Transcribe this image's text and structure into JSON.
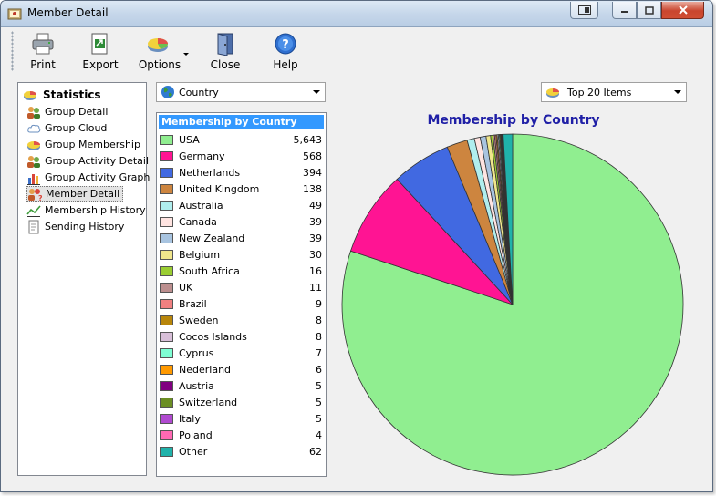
{
  "window": {
    "title": "Member Detail"
  },
  "toolbar": {
    "print_label": "Print",
    "export_label": "Export",
    "options_label": "Options",
    "close_label": "Close",
    "help_label": "Help"
  },
  "sidebar": {
    "heading": "Statistics",
    "items": [
      {
        "label": "Group Detail",
        "icon": "people-icon"
      },
      {
        "label": "Group Cloud",
        "icon": "cloud-icon"
      },
      {
        "label": "Group Membership",
        "icon": "pie-icon"
      },
      {
        "label": "Group Activity Detail",
        "icon": "people-icon"
      },
      {
        "label": "Group Activity Graph",
        "icon": "bar-chart-icon"
      },
      {
        "label": "Member Detail",
        "icon": "member-icon",
        "selected": true
      },
      {
        "label": "Membership History",
        "icon": "line-chart-icon"
      },
      {
        "label": "Sending History",
        "icon": "document-icon"
      }
    ]
  },
  "filters": {
    "dimension": "Country",
    "top": "Top 20 Items"
  },
  "list": {
    "heading": "Membership by Country"
  },
  "chart_data": {
    "type": "pie",
    "title": "Membership by Country",
    "categories": [
      "USA",
      "Germany",
      "Netherlands",
      "United Kingdom",
      "Australia",
      "Canada",
      "New Zealand",
      "Belgium",
      "South Africa",
      "UK",
      "Brazil",
      "Sweden",
      "Cocos Islands",
      "Cyprus",
      "Nederland",
      "Austria",
      "Switzerland",
      "Italy",
      "Poland",
      "Other"
    ],
    "display_values": [
      "5,643",
      "568",
      "394",
      "138",
      "49",
      "39",
      "39",
      "30",
      "16",
      "11",
      "9",
      "8",
      "8",
      "7",
      "6",
      "5",
      "5",
      "5",
      "4",
      "62"
    ],
    "values": [
      5643,
      568,
      394,
      138,
      49,
      39,
      39,
      30,
      16,
      11,
      9,
      8,
      8,
      7,
      6,
      5,
      5,
      5,
      4,
      62
    ],
    "colors": [
      "#90ee90",
      "#ff1493",
      "#4169e1",
      "#cd853f",
      "#b0eeee",
      "#ffe4e1",
      "#a8c4e0",
      "#f0e68c",
      "#9acd32",
      "#bc8f8f",
      "#f08080",
      "#b8860b",
      "#d8bfd8",
      "#7fffd4",
      "#ff9900",
      "#800080",
      "#6b8e23",
      "#b04ad0",
      "#ff69b4",
      "#20b2aa"
    ]
  }
}
